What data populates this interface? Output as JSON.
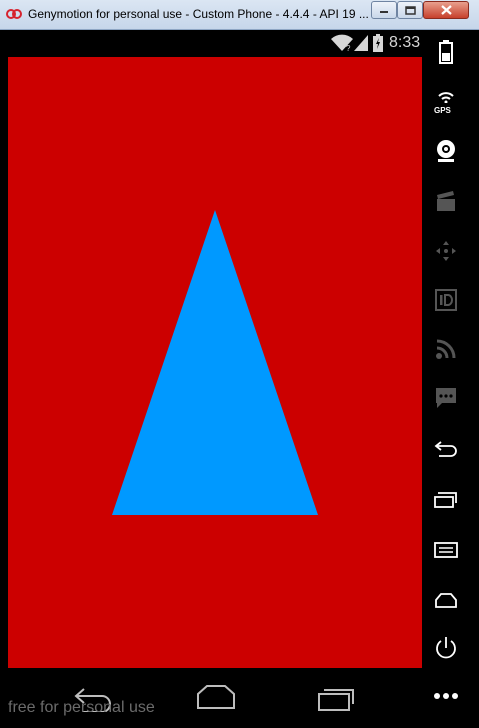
{
  "window": {
    "title": "Genymotion for personal use - Custom Phone - 4.4.4 - API 19 ..."
  },
  "status_bar": {
    "time": "8:33"
  },
  "content": {
    "background_color": "#cc0000",
    "shape": "triangle",
    "shape_color": "#0099ff"
  },
  "nav_bar": {
    "watermark": "free for personal use"
  },
  "sidebar": {
    "gps_label": "GPS",
    "icons": [
      "battery-icon",
      "gps-icon",
      "webcam-icon",
      "media-icon",
      "dpad-icon",
      "id-icon",
      "rss-icon",
      "sms-icon",
      "back-icon",
      "recent-apps-icon",
      "menu-icon",
      "home-icon",
      "power-icon",
      "more-icon"
    ]
  }
}
